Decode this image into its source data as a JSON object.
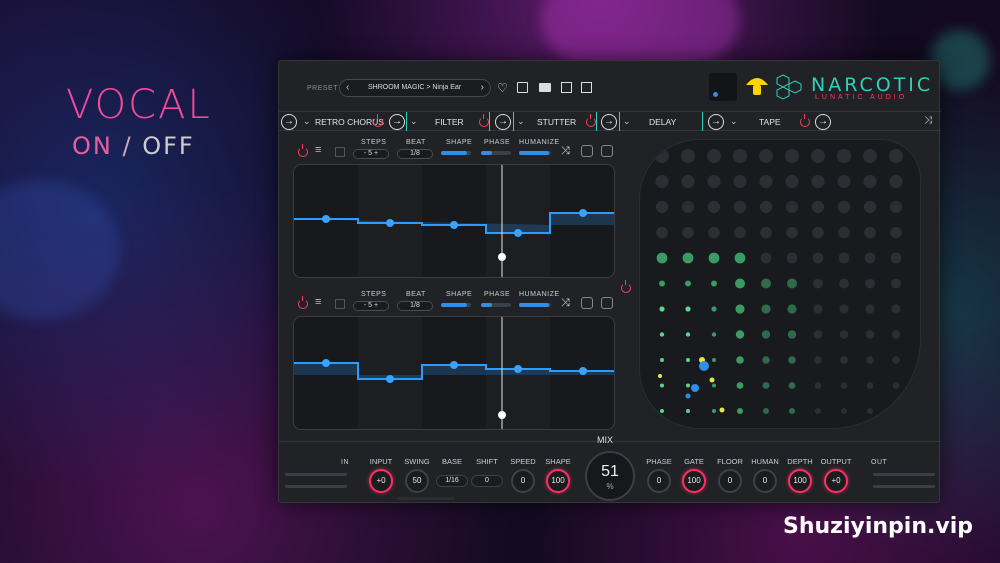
{
  "overlay": {
    "vocal": "VOCAL",
    "on": "ON",
    "sep": " / ",
    "off": "OFF",
    "watermark": "Shuziyinpin.vip"
  },
  "header": {
    "preset_label": "PRESET",
    "preset_name": "SHROOM MAGIC > Ninja Ear",
    "brand": "NARCOTIC",
    "sub_brand": "LUNATIC AUDIO"
  },
  "chain": {
    "slots": [
      "RETRO CHORUS",
      "FILTER",
      "STUTTER",
      "DELAY",
      "TAPE"
    ]
  },
  "seq1": {
    "steps_label": "STEPS",
    "steps": "5",
    "beat_label": "BEAT",
    "beat": "1/8",
    "shape_label": "SHAPE",
    "shape": 0.85,
    "phase_label": "PHASE",
    "phase": 0.35,
    "humanize_label": "HUMANIZE",
    "humanize": 0.95
  },
  "seq2": {
    "steps_label": "STEPS",
    "steps": "5",
    "beat_label": "BEAT",
    "beat": "1/8",
    "shape_label": "SHAPE",
    "shape": 0.85,
    "phase_label": "PHASE",
    "phase": 0.35,
    "humanize_label": "HUMANIZE",
    "humanize": 0.95
  },
  "bottom": {
    "in_label": "IN",
    "out_label": "OUT",
    "mix_label": "MIX",
    "mix_value": "51",
    "mix_unit": "%",
    "knobs": [
      {
        "label": "INPUT",
        "value": "+0",
        "accent": true
      },
      {
        "label": "SWING",
        "value": "50",
        "accent": false
      },
      {
        "label": "BASE",
        "value": "1/16",
        "accent": false
      },
      {
        "label": "SHIFT",
        "value": "0",
        "accent": false
      },
      {
        "label": "SPEED",
        "value": "0",
        "accent": false
      },
      {
        "label": "SHAPE",
        "value": "100",
        "accent": true
      },
      {
        "label": "PHASE",
        "value": "0",
        "accent": false
      },
      {
        "label": "GATE",
        "value": "100",
        "accent": true
      },
      {
        "label": "FLOOR",
        "value": "0",
        "accent": false
      },
      {
        "label": "HUMAN",
        "value": "0",
        "accent": false
      },
      {
        "label": "DEPTH",
        "value": "100",
        "accent": true
      },
      {
        "label": "OUTPUT",
        "value": "+0",
        "accent": true
      }
    ]
  },
  "colors": {
    "accent_pink": "#ff2f62",
    "accent_blue": "#2f8fe6",
    "brand": "#2fd1b8",
    "mushroom": "#ffd400"
  }
}
